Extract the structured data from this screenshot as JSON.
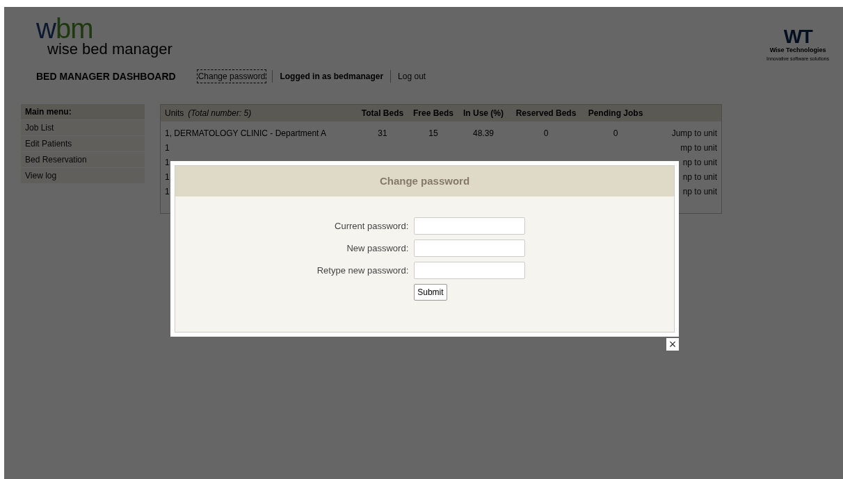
{
  "logo": {
    "mark_left": "w",
    "mark_right": "bm",
    "name": "wise bed manager"
  },
  "company_logo": {
    "mark": "WT",
    "name": "Wise Technologies",
    "tagline": "Innovative software solutions"
  },
  "header": {
    "title": "BED MANAGER DASHBOARD",
    "links": [
      {
        "label": "Change password",
        "selected": true
      },
      {
        "label": "Logged in as bedmanager",
        "selected": false
      },
      {
        "label": "Log out",
        "selected": false
      }
    ]
  },
  "sidebar": {
    "title": "Main menu:",
    "items": [
      "Job List",
      "Edit Patients",
      "Bed Reservation",
      "View log"
    ]
  },
  "table": {
    "count": "(Total number: 5)",
    "columns": [
      "Units",
      "Total Beds",
      "Free Beds",
      "In Use (%)",
      "Reserved Beds",
      "Pending Jobs"
    ],
    "rows": [
      [
        "1, DERMATOLOGY CLINIC - Department A",
        "31",
        "15",
        "48.39",
        "0",
        "0",
        "Jump to unit"
      ],
      [
        "1",
        "",
        "",
        "",
        "",
        "",
        "mp to unit"
      ],
      [
        "1",
        "",
        "",
        "",
        "",
        "",
        "np to unit"
      ],
      [
        "1",
        "",
        "",
        "",
        "",
        "",
        "np to unit"
      ],
      [
        "1",
        "",
        "",
        "",
        "",
        "",
        "np to unit"
      ]
    ]
  },
  "modal": {
    "title": "Change password",
    "fields": [
      {
        "label": "Current password:"
      },
      {
        "label": "New password:"
      },
      {
        "label": "Retype new password:"
      }
    ],
    "submit": "Submit",
    "close": "×"
  }
}
